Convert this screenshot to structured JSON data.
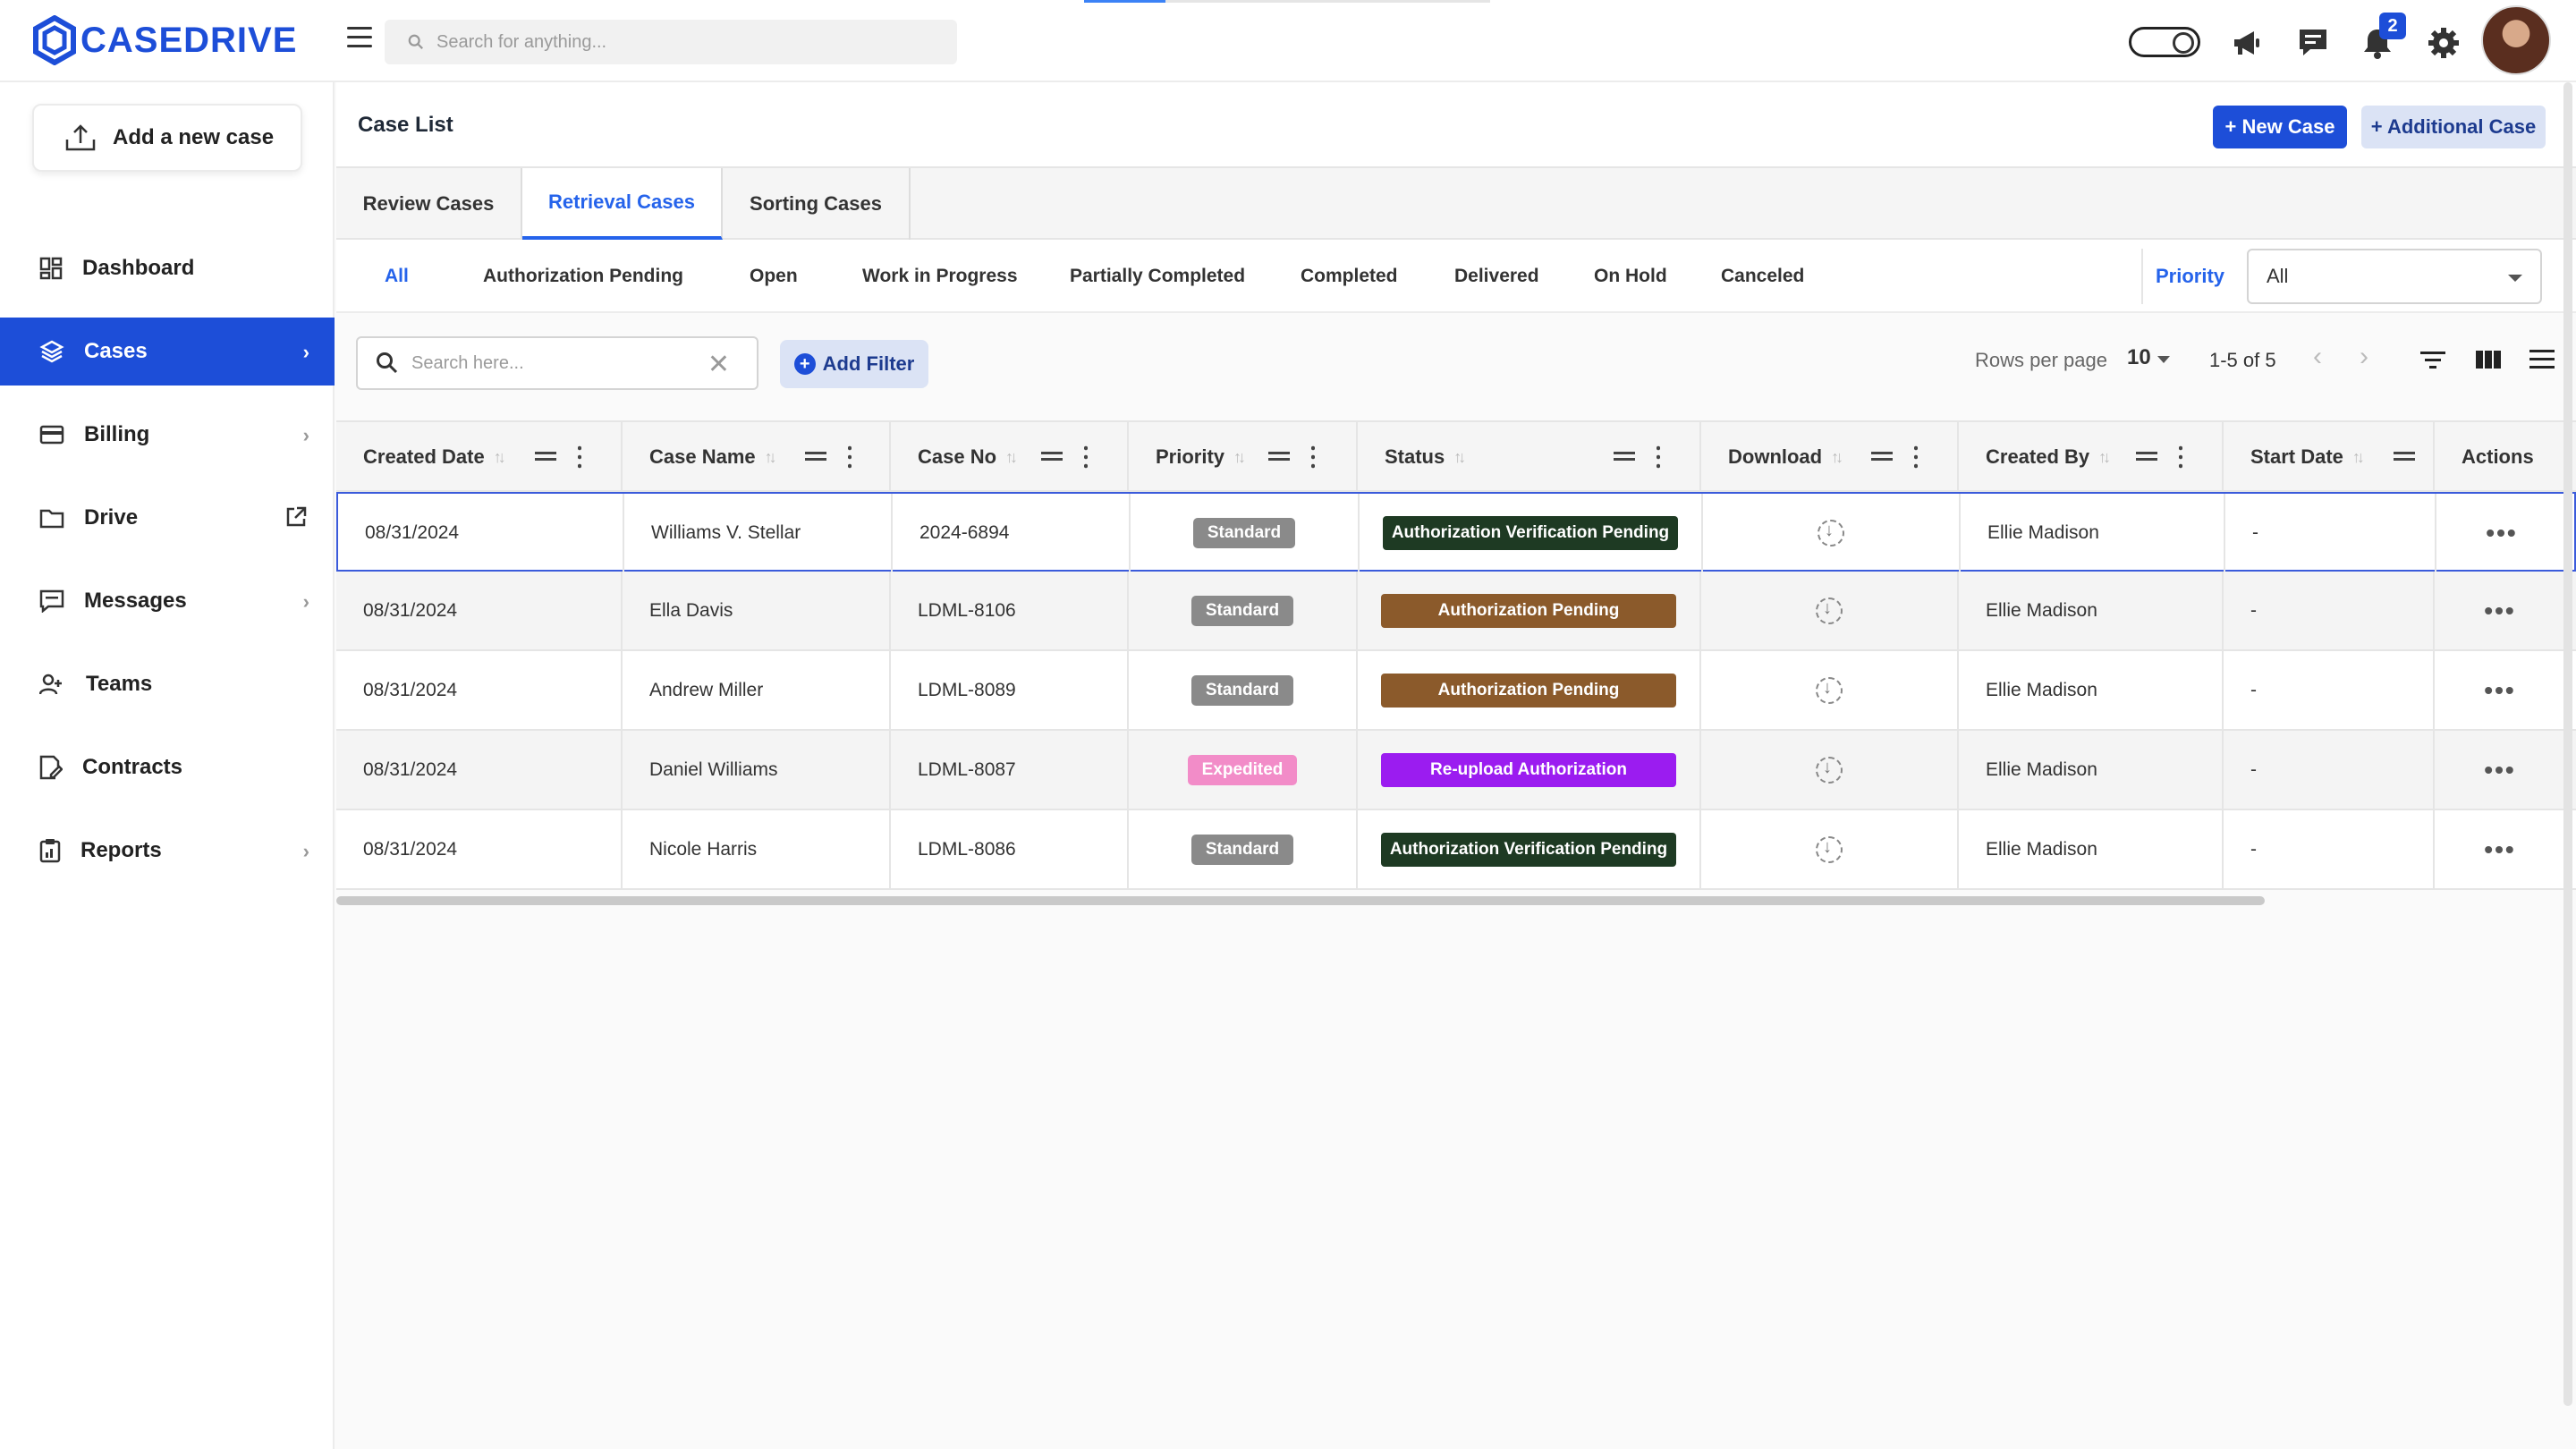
{
  "app": {
    "logo_text": "CASEDRIVE",
    "brand_color": "#1d4ed8"
  },
  "topbar": {
    "search_placeholder": "Search for anything...",
    "notification_count": "2",
    "icons": [
      "menu-icon",
      "search-icon",
      "theme-toggle",
      "megaphone-icon",
      "chat-icon",
      "bell-icon",
      "gear-icon",
      "avatar"
    ]
  },
  "sidebar": {
    "add_case_label": "Add a new case",
    "items": [
      {
        "label": "Dashboard",
        "icon": "dashboard-icon"
      },
      {
        "label": "Cases",
        "icon": "layers-icon",
        "active": true
      },
      {
        "label": "Billing",
        "icon": "card-icon"
      },
      {
        "label": "Drive",
        "icon": "folder-icon"
      },
      {
        "label": "Messages",
        "icon": "message-icon"
      },
      {
        "label": "Teams",
        "icon": "team-icon"
      },
      {
        "label": "Contracts",
        "icon": "contract-icon"
      },
      {
        "label": "Reports",
        "icon": "report-icon"
      }
    ]
  },
  "page": {
    "title": "Case List",
    "new_case_label": "+ New Case",
    "additional_case_label": "+ Additional Case"
  },
  "tabs": [
    "Review Cases",
    "Retrieval Cases",
    "Sorting Cases"
  ],
  "status_filters": [
    "All",
    "Authorization Pending",
    "Open",
    "Work in Progress",
    "Partially Completed",
    "Completed",
    "Delivered",
    "On Hold",
    "Canceled"
  ],
  "priority_filter": {
    "label": "Priority",
    "value": "All"
  },
  "toolbar": {
    "search_placeholder": "Search here...",
    "add_filter_label": "Add Filter",
    "rows_per_page_label": "Rows per page",
    "rows_per_page_value": "10",
    "pagination_info": "1-5 of 5"
  },
  "table": {
    "columns": [
      "Created Date",
      "Case Name",
      "Case No",
      "Priority",
      "Status",
      "Download",
      "Created By",
      "Start Date",
      "Actions"
    ],
    "rows": [
      {
        "created_date": "08/31/2024",
        "case_name": "Williams V. Stellar",
        "case_no": "2024-6894",
        "priority": "Standard",
        "status": "Authorization Verification Pending",
        "created_by": "Ellie Madison",
        "start_date": "-"
      },
      {
        "created_date": "08/31/2024",
        "case_name": "Ella Davis",
        "case_no": "LDML-8106",
        "priority": "Standard",
        "status": "Authorization Pending",
        "created_by": "Ellie Madison",
        "start_date": "-"
      },
      {
        "created_date": "08/31/2024",
        "case_name": "Andrew Miller",
        "case_no": "LDML-8089",
        "priority": "Standard",
        "status": "Authorization Pending",
        "created_by": "Ellie Madison",
        "start_date": "-"
      },
      {
        "created_date": "08/31/2024",
        "case_name": "Daniel Williams",
        "case_no": "LDML-8087",
        "priority": "Expedited",
        "status": "Re-upload Authorization",
        "created_by": "Ellie Madison",
        "start_date": "-"
      },
      {
        "created_date": "08/31/2024",
        "case_name": "Nicole Harris",
        "case_no": "LDML-8086",
        "priority": "Standard",
        "status": "Authorization Verification Pending",
        "created_by": "Ellie Madison",
        "start_date": "-"
      }
    ]
  },
  "colors": {
    "priority_standard": "#8a8a8a",
    "priority_expedited": "#f28cc8",
    "status_verification": "#1e3a23",
    "status_pending": "#8b5a2b",
    "status_reupload": "#9b1cf0"
  }
}
